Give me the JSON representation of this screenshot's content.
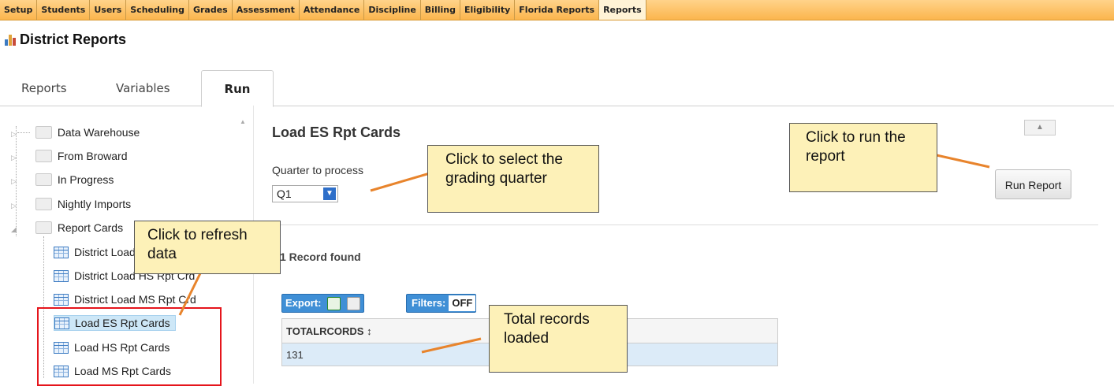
{
  "menu": {
    "items": [
      "Setup",
      "Students",
      "Users",
      "Scheduling",
      "Grades",
      "Assessment",
      "Attendance",
      "Discipline",
      "Billing",
      "Eligibility",
      "Florida Reports",
      "Reports"
    ],
    "active": "Reports"
  },
  "page": {
    "title": "District Reports"
  },
  "tabs": [
    "Reports",
    "Variables",
    "Run"
  ],
  "tree": {
    "folders": [
      "Data Warehouse",
      "From Broward",
      "In Progress",
      "Nightly Imports",
      "Report Cards"
    ],
    "reports": [
      "District Load ES Rpt Crd",
      "District Load HS Rpt Crd",
      "District Load MS Rpt Crd",
      "Load ES Rpt Cards",
      "Load HS Rpt Cards",
      "Load MS Rpt Cards"
    ],
    "selected": "Load ES Rpt Cards"
  },
  "main": {
    "heading": "Load ES Rpt Cards",
    "quarter_label": "Quarter to process",
    "quarter_value": "Q1",
    "run_button": "Run Report",
    "records_found": "1 Record found",
    "export_label": "Export:",
    "filters_label": "Filters:",
    "filters_state": "OFF",
    "grid": {
      "column": "TOTALRCORDS ↕",
      "value": "131"
    }
  },
  "callouts": {
    "quarter": "Click to select the grading quarter",
    "run": "Click to run the report",
    "refresh": "Click to refresh data",
    "total": "Total records loaded"
  },
  "colors": {
    "menu_bar": "#fbb54d",
    "accent_blue": "#3f8fd6",
    "callout_fill": "#fdf1b8",
    "annotation_line": "#e8842c",
    "highlight_box": "#e5151c"
  }
}
